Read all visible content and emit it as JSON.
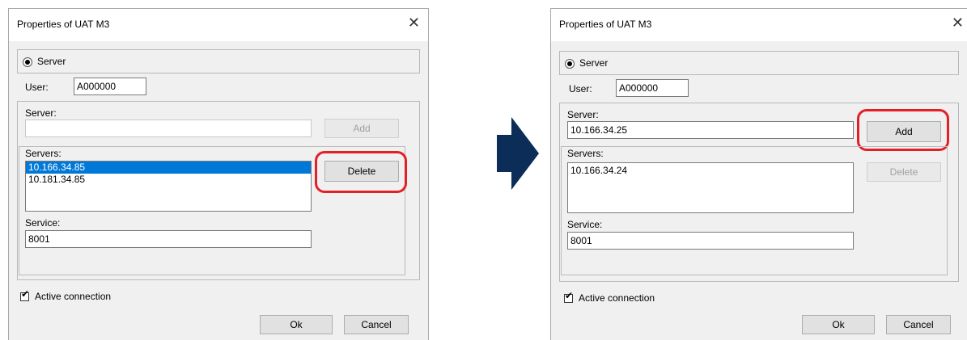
{
  "colors": {
    "highlight": "#e32026",
    "arrow": "#0b2d57",
    "selection": "#0078d7"
  },
  "left": {
    "title": "Properties of UAT M3",
    "server_radio": "Server",
    "user_label": "User:",
    "user_value": "A000000",
    "server_label": "Server:",
    "server_value": "",
    "add_label": "Add",
    "servers_label": "Servers:",
    "servers": [
      "10.166.34.85",
      "10.181.34.85"
    ],
    "delete_label": "Delete",
    "service_label": "Service:",
    "service_value": "8001",
    "active_label": "Active connection",
    "ok_label": "Ok",
    "cancel_label": "Cancel"
  },
  "right": {
    "title": "Properties of UAT M3",
    "server_radio": "Server",
    "user_label": "User:",
    "user_value": "A000000",
    "server_label": "Server:",
    "server_value": "10.166.34.25",
    "add_label": "Add",
    "servers_label": "Servers:",
    "servers": [
      "10.166.34.24"
    ],
    "delete_label": "Delete",
    "service_label": "Service:",
    "service_value": "8001",
    "active_label": "Active connection",
    "ok_label": "Ok",
    "cancel_label": "Cancel"
  }
}
